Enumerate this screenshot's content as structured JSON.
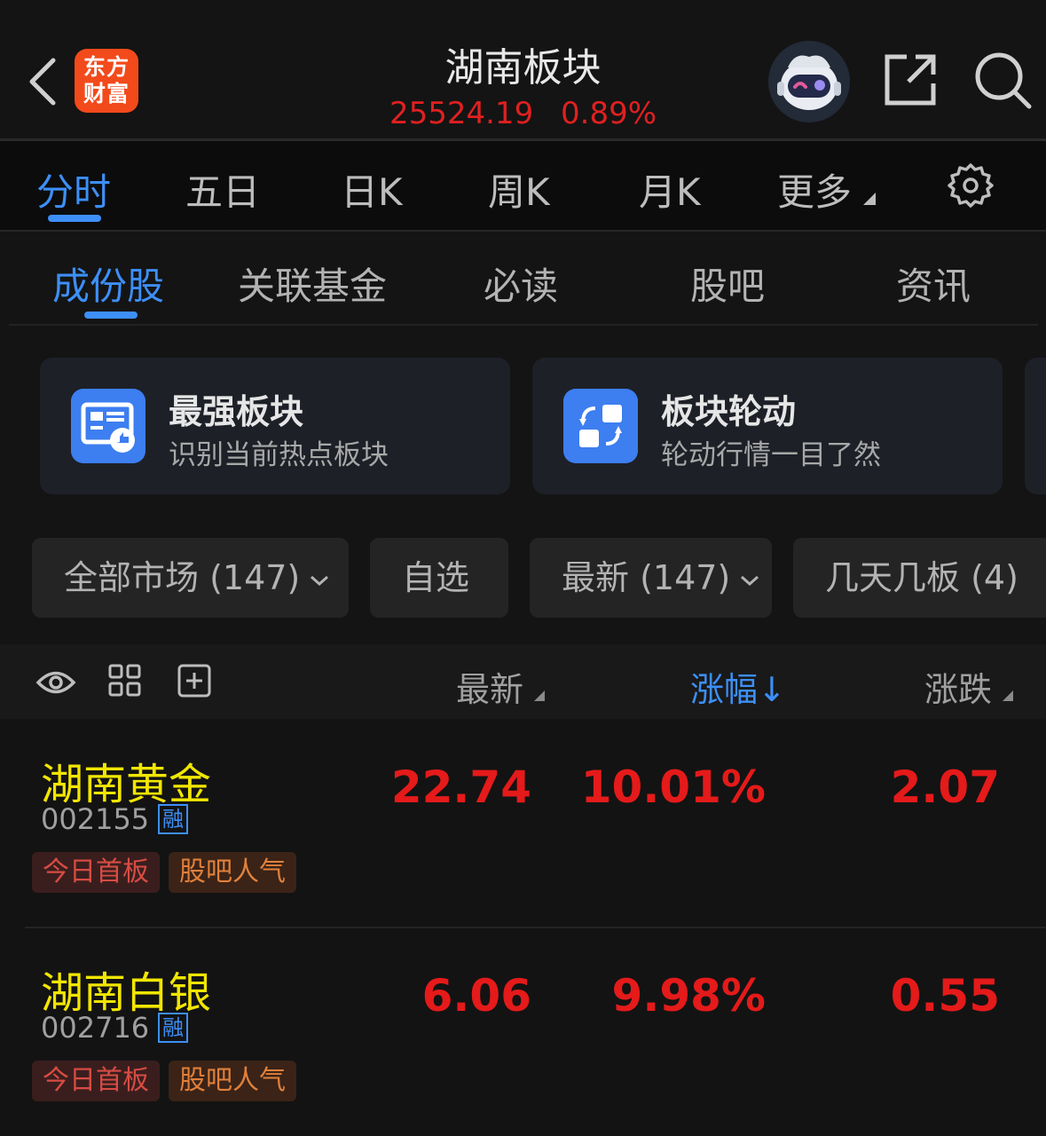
{
  "header": {
    "logo_line1": "东方",
    "logo_line2": "财富",
    "title": "湖南板块",
    "index_value": "25524.19",
    "index_change": "0.89%"
  },
  "period_tabs": [
    "分时",
    "五日",
    "日K",
    "周K",
    "月K",
    "更多"
  ],
  "content_tabs": [
    "成份股",
    "关联基金",
    "必读",
    "股吧",
    "资讯"
  ],
  "cards": [
    {
      "title": "最强板块",
      "subtitle": "识别当前热点板块"
    },
    {
      "title": "板块轮动",
      "subtitle": "轮动行情一目了然"
    }
  ],
  "filters": [
    {
      "label": "全部市场 (147)"
    },
    {
      "label": "自选"
    },
    {
      "label": "最新 (147)"
    },
    {
      "label": "几天几板 (4)"
    }
  ],
  "columns": {
    "latest": "最新",
    "change_pct": "涨幅↓",
    "change": "涨跌"
  },
  "stocks": [
    {
      "name": "湖南黄金",
      "code": "002155",
      "margin": "融",
      "price": "22.74",
      "pct": "10.01%",
      "change": "2.07",
      "tags": [
        "今日首板",
        "股吧人气"
      ]
    },
    {
      "name": "湖南白银",
      "code": "002716",
      "margin": "融",
      "price": "6.06",
      "pct": "9.98%",
      "change": "0.55",
      "tags": [
        "今日首板",
        "股吧人气"
      ]
    }
  ],
  "colors": {
    "up": "#e51a1a",
    "accent": "#3d8ff7",
    "stock_name": "#f2e600",
    "background": "#141414"
  }
}
